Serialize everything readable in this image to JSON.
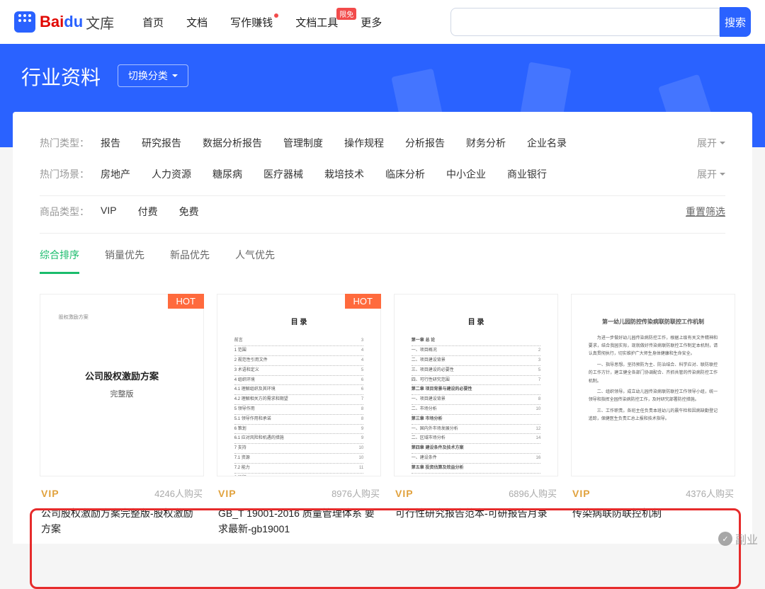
{
  "logo": {
    "bai": "Bai",
    "du": "du",
    "wenku": "文库"
  },
  "nav": {
    "items": [
      {
        "label": "首页",
        "dot": false,
        "badge": null
      },
      {
        "label": "文档",
        "dot": false,
        "badge": null
      },
      {
        "label": "写作赚钱",
        "dot": true,
        "badge": null
      },
      {
        "label": "文档工具",
        "dot": false,
        "badge": "限免"
      },
      {
        "label": "更多",
        "dot": false,
        "badge": null
      }
    ]
  },
  "search": {
    "placeholder": "",
    "button": "搜索"
  },
  "banner": {
    "title": "行业资料",
    "switch": "切换分类"
  },
  "filters": {
    "type": {
      "label": "热门类型：",
      "items": [
        "报告",
        "研究报告",
        "数据分析报告",
        "管理制度",
        "操作规程",
        "分析报告",
        "财务分析",
        "企业名录"
      ],
      "expand": "展开"
    },
    "scene": {
      "label": "热门场景：",
      "items": [
        "房地产",
        "人力资源",
        "糖尿病",
        "医疗器械",
        "栽培技术",
        "临床分析",
        "中小企业",
        "商业银行"
      ],
      "expand": "展开"
    },
    "product": {
      "label": "商品类型：",
      "items": [
        "VIP",
        "付费",
        "免费"
      ],
      "reset": "重置筛选"
    }
  },
  "sort": {
    "items": [
      "综合排序",
      "销量优先",
      "新品优先",
      "人气优先"
    ],
    "active": 0
  },
  "cards": [
    {
      "hot": "HOT",
      "thumb_type": "cover",
      "thumb_title_1": "公司股权激励方案",
      "thumb_title_2": "完整版",
      "thumb_mini": "股权激励方案",
      "vip": "VIP",
      "buyers": "4246人购买",
      "title": "公司股权激励方案完整版-股权激励方案"
    },
    {
      "hot": "HOT",
      "thumb_type": "toc",
      "thumb_head": "目 录",
      "vip": "VIP",
      "buyers": "8976人购买",
      "title": "GB_T 19001-2016 质量管理体系 要求最新-gb19001"
    },
    {
      "hot": null,
      "thumb_type": "toc2",
      "thumb_head": "目 录",
      "vip": "VIP",
      "buyers": "6896人购买",
      "title": "可行性研究报告范本-可研报告月录"
    },
    {
      "hot": null,
      "thumb_type": "text",
      "thumb_head": "第一幼儿园防控传染病联防联控工作机制",
      "vip": "VIP",
      "buyers": "4376人购买",
      "title": "传染病联防联控机制"
    }
  ],
  "watermark": {
    "icon": "✓",
    "text": "副业"
  }
}
